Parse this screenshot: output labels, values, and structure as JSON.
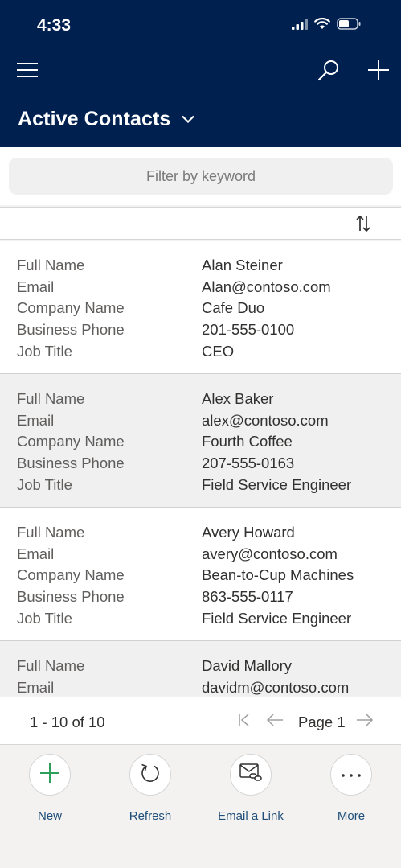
{
  "status_bar": {
    "time": "4:33"
  },
  "header": {
    "view_title": "Active Contacts"
  },
  "filter": {
    "placeholder": "Filter by keyword"
  },
  "records": [
    {
      "fields": [
        {
          "label": "Full Name",
          "value": "Alan Steiner"
        },
        {
          "label": "Email",
          "value": "Alan@contoso.com"
        },
        {
          "label": "Company Name",
          "value": "Cafe Duo"
        },
        {
          "label": "Business Phone",
          "value": "201-555-0100"
        },
        {
          "label": "Job Title",
          "value": "CEO"
        }
      ]
    },
    {
      "fields": [
        {
          "label": "Full Name",
          "value": "Alex Baker"
        },
        {
          "label": "Email",
          "value": "alex@contoso.com"
        },
        {
          "label": "Company Name",
          "value": "Fourth Coffee"
        },
        {
          "label": "Business Phone",
          "value": "207-555-0163"
        },
        {
          "label": "Job Title",
          "value": "Field Service Engineer"
        }
      ]
    },
    {
      "fields": [
        {
          "label": "Full Name",
          "value": "Avery Howard"
        },
        {
          "label": "Email",
          "value": "avery@contoso.com"
        },
        {
          "label": "Company Name",
          "value": "Bean-to-Cup Machines"
        },
        {
          "label": "Business Phone",
          "value": "863-555-0117"
        },
        {
          "label": "Job Title",
          "value": "Field Service Engineer"
        }
      ]
    },
    {
      "fields": [
        {
          "label": "Full Name",
          "value": "David Mallory"
        },
        {
          "label": "Email",
          "value": "davidm@contoso.com"
        }
      ]
    }
  ],
  "pagination": {
    "count_text": "1 - 10 of 10",
    "page_label": "Page 1"
  },
  "commands": {
    "new": "New",
    "refresh": "Refresh",
    "email_link": "Email a Link",
    "more": "More"
  },
  "colors": {
    "header_bg": "#002050",
    "accent_green": "#2e9e5b",
    "command_label": "#1f4e79"
  }
}
